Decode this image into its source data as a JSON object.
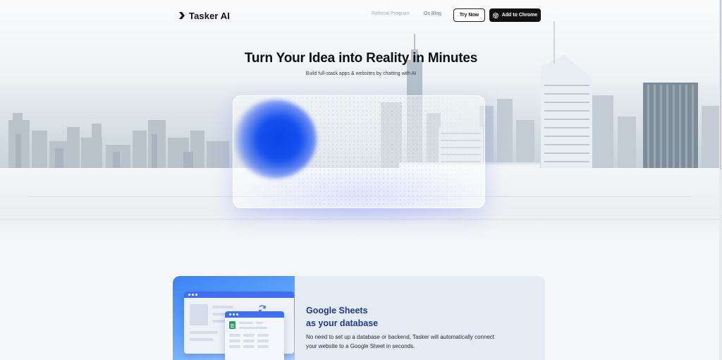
{
  "brand": {
    "name": "Tasker AI",
    "icon": "chevron-logo-icon"
  },
  "nav": {
    "links": [
      {
        "label": "Referral Program",
        "state": "faded"
      },
      {
        "label": "Os Blog",
        "state": "normal"
      }
    ],
    "try_button": "Try Now",
    "chrome_button": "Add to Chrome",
    "chrome_icon": "chrome-icon"
  },
  "hero": {
    "title": "Turn Your Idea into Reality in Minutes",
    "subtitle": "Build full-stack apps & websites by chatting with AI"
  },
  "feature": {
    "title_line1": "Google Sheets",
    "title_line2": "as your database",
    "description": "No need to set up a database or backend, Tasker will automatically connect your website to a Google Sheet in seconds.",
    "icons": [
      "google-sheets-icon",
      "sync-icon"
    ]
  },
  "colors": {
    "accent_blue": "#0a44e8",
    "feature_title": "#1e3a8a",
    "feature_bg": "#e6ecf6",
    "button_dark": "#111111"
  }
}
